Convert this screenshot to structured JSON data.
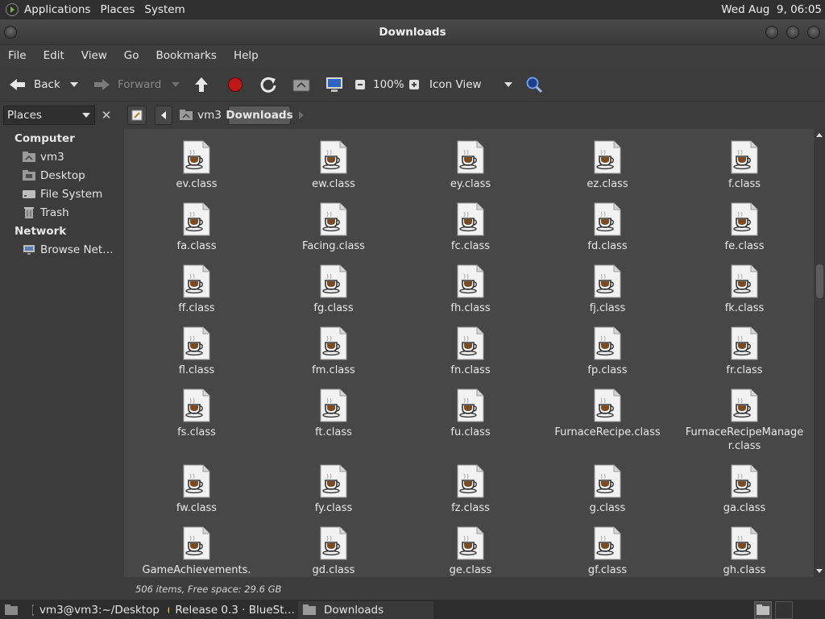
{
  "topbar": {
    "menus": [
      "Applications",
      "Places",
      "System"
    ],
    "clock": "Wed Aug  9, 06:05"
  },
  "window": {
    "title": "Downloads"
  },
  "menubar": [
    "File",
    "Edit",
    "View",
    "Go",
    "Bookmarks",
    "Help"
  ],
  "toolbar": {
    "back": "Back",
    "forward": "Forward",
    "zoom": "100%",
    "view_mode": "Icon View"
  },
  "sidebar": {
    "pane_title": "Places",
    "computer_label": "Computer",
    "computer_items": [
      "vm3",
      "Desktop",
      "File System",
      "Trash"
    ],
    "network_label": "Network",
    "network_items": [
      "Browse Net…"
    ]
  },
  "pathbar": [
    "vm3",
    "Downloads"
  ],
  "files": [
    [
      "ev.class",
      "ew.class",
      "ey.class",
      "ez.class",
      "f.class"
    ],
    [
      "fa.class",
      "Facing.class",
      "fc.class",
      "fd.class",
      "fe.class"
    ],
    [
      "ff.class",
      "fg.class",
      "fh.class",
      "fj.class",
      "fk.class"
    ],
    [
      "fl.class",
      "fm.class",
      "fn.class",
      "fp.class",
      "fr.class"
    ],
    [
      "fs.class",
      "ft.class",
      "fu.class",
      "FurnaceRecipe.class",
      "FurnaceRecipeManage\nr.class"
    ],
    [
      "fw.class",
      "fy.class",
      "fz.class",
      "g.class",
      "ga.class"
    ],
    [
      "GameAchievements.",
      "gd.class",
      "ge.class",
      "gf.class",
      "gh.class"
    ]
  ],
  "status": "506 items, Free space: 29.6 GB",
  "taskbar": [
    "vm3@vm3:~/Desktop",
    "Release 0.3 · BlueSt…",
    "Downloads"
  ],
  "colors": {
    "accent": "#3b5fa8",
    "background": "#474747",
    "panel": "#3c3c3c"
  }
}
